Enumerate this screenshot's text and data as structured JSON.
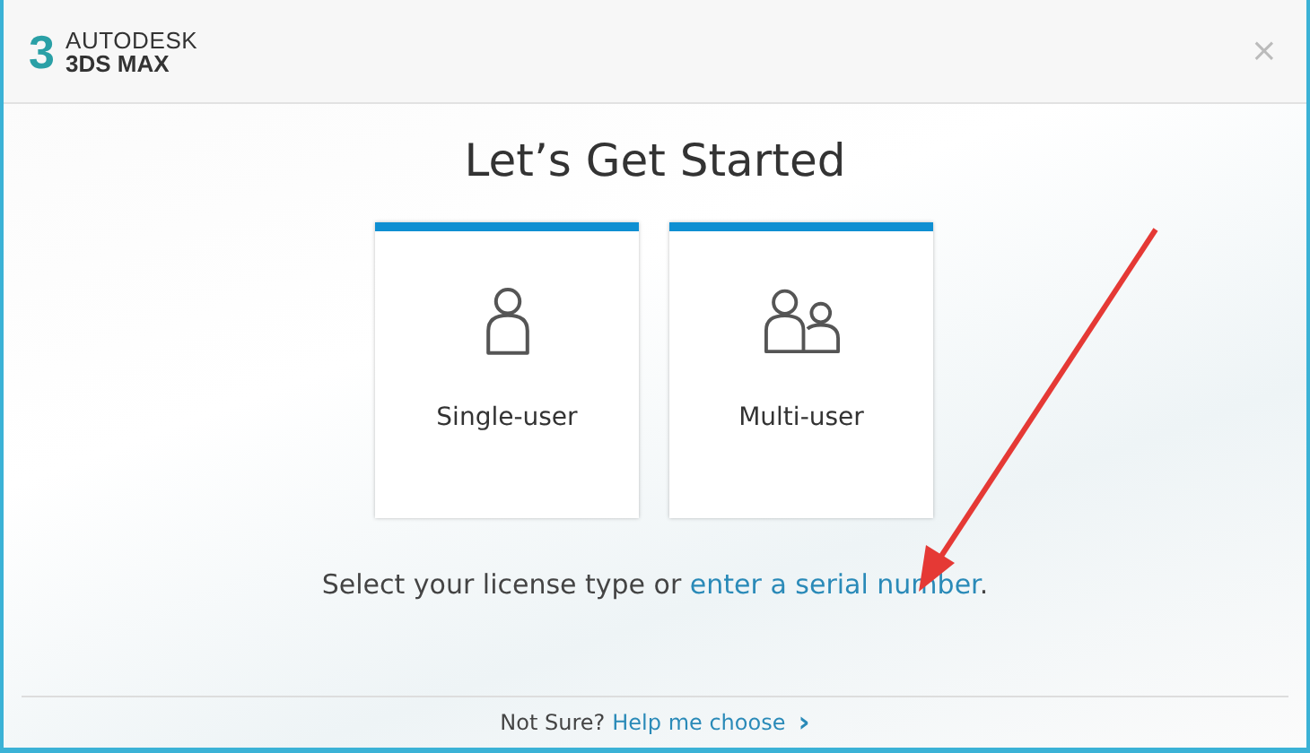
{
  "header": {
    "logo_mark": "3",
    "brand": "AUTODESK",
    "product": "3DS MAX",
    "close": "×"
  },
  "title": "Let’s Get Started",
  "options": [
    {
      "kind": "single",
      "label": "Single-user"
    },
    {
      "kind": "multi",
      "label": "Multi-user"
    }
  ],
  "prompt": {
    "text": "Select your license type or ",
    "link": "enter a serial number",
    "after": "."
  },
  "footer": {
    "text": "Not Sure?",
    "link": "Help me choose",
    "chevron": "›"
  }
}
